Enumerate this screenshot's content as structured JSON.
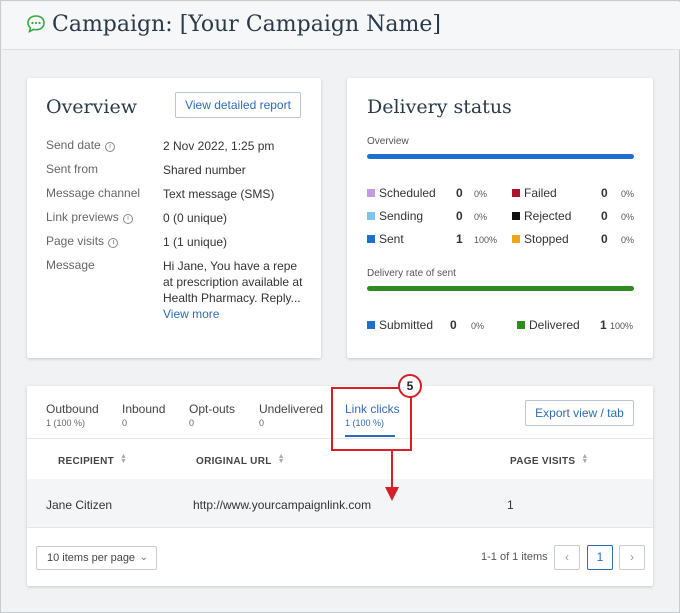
{
  "header": {
    "title": "Campaign: [Your Campaign Name]"
  },
  "overview": {
    "title": "Overview",
    "report_button": "View detailed report",
    "rows": [
      {
        "label": "Send date",
        "value": "2 Nov 2022, 1:25 pm",
        "info": true
      },
      {
        "label": "Sent from",
        "value": "Shared number",
        "info": false
      },
      {
        "label": "Message channel",
        "value": "Text message (SMS)",
        "info": false
      },
      {
        "label": "Link previews",
        "value": "0 (0 unique)",
        "info": true
      },
      {
        "label": "Page visits",
        "value": "1 (1 unique)",
        "info": true
      },
      {
        "label": "Message",
        "value": "Hi Jane, You have a repeat prescription available at Health Pharmacy. Reply...",
        "info": false
      }
    ],
    "view_more": "View more",
    "info_glyph": "i"
  },
  "delivery": {
    "title": "Delivery status",
    "overview_label": "Overview",
    "rate_label": "Delivery rate of sent",
    "overview_stats": [
      {
        "label": "Scheduled",
        "count": "0",
        "pct": "0%",
        "color": "#c39be0"
      },
      {
        "label": "Sending",
        "count": "0",
        "pct": "0%",
        "color": "#7fc3ec"
      },
      {
        "label": "Sent",
        "count": "1",
        "pct": "100%",
        "color": "#1f6fd1"
      },
      {
        "label": "Failed",
        "count": "0",
        "pct": "0%",
        "color": "#b0102a"
      },
      {
        "label": "Rejected",
        "count": "0",
        "pct": "0%",
        "color": "#111111"
      },
      {
        "label": "Stopped",
        "count": "0",
        "pct": "0%",
        "color": "#f0a418"
      }
    ],
    "rate_stats": [
      {
        "label": "Submitted",
        "count": "0",
        "pct": "0%",
        "color": "#1f6fd1"
      },
      {
        "label": "Delivered",
        "count": "1",
        "pct": "100%",
        "color": "#2e8b1f"
      }
    ],
    "overview_bar_color": "#1f6fd1",
    "rate_bar_color": "#2e8b1f"
  },
  "tabs": [
    {
      "label": "Outbound",
      "sub": "1 (100 %)"
    },
    {
      "label": "Inbound",
      "sub": "0"
    },
    {
      "label": "Opt-outs",
      "sub": "0"
    },
    {
      "label": "Undelivered",
      "sub": "0"
    },
    {
      "label": "Link clicks",
      "sub": "1 (100 %)"
    }
  ],
  "export_button": "Export view / tab",
  "table": {
    "columns": [
      "RECIPIENT",
      "ORIGINAL URL",
      "PAGE VISITS"
    ],
    "rows": [
      [
        "Jane Citizen",
        "http://www.yourcampaignlink.com",
        "1"
      ]
    ]
  },
  "pagination": {
    "per_page": "10 items per page",
    "range_text": "1-1 of 1 items",
    "current_page": "1",
    "prev_glyph": "‹",
    "next_glyph": "›",
    "chevron_glyph": "⌄"
  },
  "callout": {
    "number": "5",
    "color": "#d71f26"
  },
  "colors": {
    "accent": "#2d6db5",
    "brand_green": "#3aa845"
  }
}
